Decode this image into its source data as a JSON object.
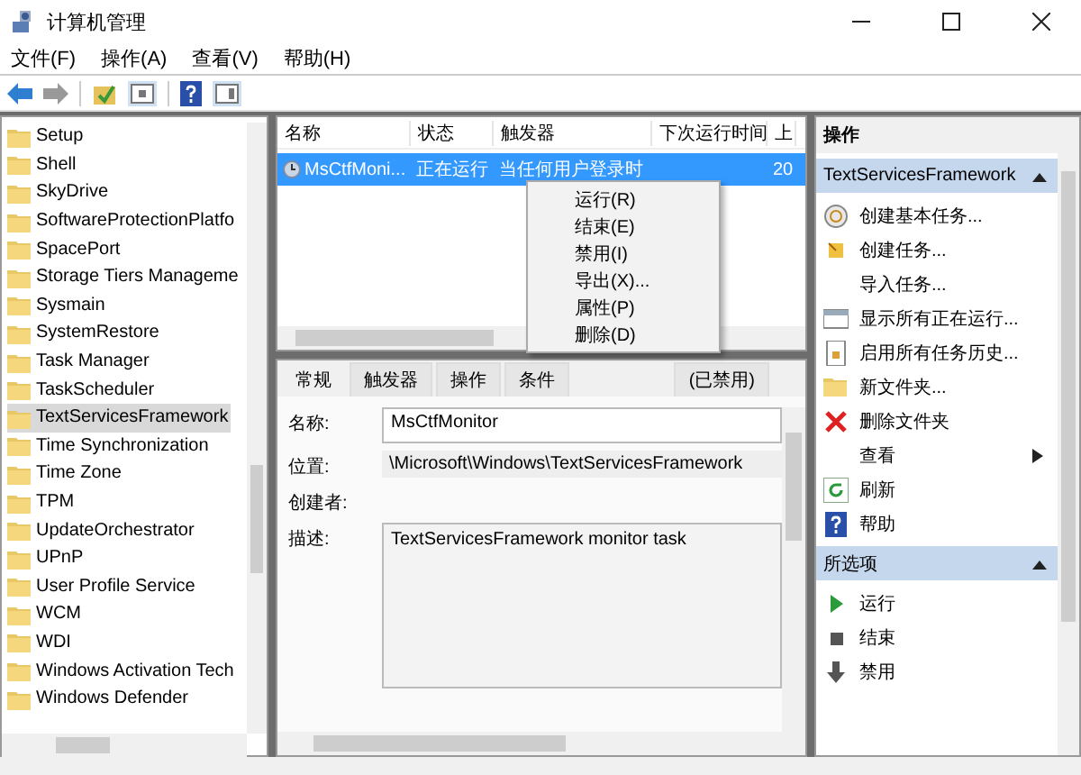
{
  "window": {
    "title": "计算机管理"
  },
  "menu": [
    "文件(F)",
    "操作(A)",
    "查看(V)",
    "帮助(H)"
  ],
  "tree": {
    "items": [
      {
        "label": "Setup",
        "selected": false
      },
      {
        "label": "Shell",
        "selected": false
      },
      {
        "label": "SkyDrive",
        "selected": false
      },
      {
        "label": "SoftwareProtectionPlatfo",
        "selected": false
      },
      {
        "label": "SpacePort",
        "selected": false
      },
      {
        "label": "Storage Tiers Manageme",
        "selected": false
      },
      {
        "label": "Sysmain",
        "selected": false
      },
      {
        "label": "SystemRestore",
        "selected": false
      },
      {
        "label": "Task Manager",
        "selected": false
      },
      {
        "label": "TaskScheduler",
        "selected": false
      },
      {
        "label": "TextServicesFramework",
        "selected": true
      },
      {
        "label": "Time Synchronization",
        "selected": false
      },
      {
        "label": "Time Zone",
        "selected": false
      },
      {
        "label": "TPM",
        "selected": false
      },
      {
        "label": "UpdateOrchestrator",
        "selected": false
      },
      {
        "label": "UPnP",
        "selected": false
      },
      {
        "label": "User Profile Service",
        "selected": false
      },
      {
        "label": "WCM",
        "selected": false
      },
      {
        "label": "WDI",
        "selected": false
      },
      {
        "label": "Windows Activation Tech",
        "selected": false
      },
      {
        "label": "Windows Defender",
        "selected": false
      }
    ]
  },
  "task_list": {
    "columns": [
      "名称",
      "状态",
      "触发器",
      "下次运行时间",
      "上"
    ],
    "rows": [
      {
        "cells": [
          "MsCtfMoni...",
          "正在运行",
          "当任何用户登录时",
          null,
          "20"
        ],
        "selected": true
      }
    ]
  },
  "context_menu": {
    "items": [
      "运行(R)",
      "结束(E)",
      "禁用(I)",
      "导出(X)...",
      "属性(P)",
      "删除(D)"
    ]
  },
  "detail": {
    "tabs": [
      {
        "label": "常规",
        "selected": true
      },
      {
        "label": "触发器",
        "selected": false
      },
      {
        "label": "操作",
        "selected": false
      },
      {
        "label": "条件",
        "selected": false
      },
      {
        "label": "(已禁用)",
        "selected": false
      }
    ],
    "fields": [
      {
        "kind": "field",
        "label": "名称:",
        "value": "MsCtfMonitor"
      },
      {
        "kind": "text",
        "label": "位置:",
        "value": "\\Microsoft\\Windows\\TextServicesFramework"
      },
      {
        "kind": "text",
        "label": "创建者:"
      },
      {
        "kind": "area",
        "label": "描述:",
        "value": "TextServicesFramework monitor task"
      }
    ]
  },
  "actions": {
    "title": "操作",
    "sections": [
      {
        "title": "TextServicesFramework",
        "expanded": true,
        "items": [
          {
            "label": "创建基本任务...",
            "submenu": false
          },
          {
            "label": "创建任务...",
            "submenu": false
          },
          {
            "label": "导入任务...",
            "submenu": false
          },
          {
            "label": "显示所有正在运行...",
            "submenu": false
          },
          {
            "label": "启用所有任务历史...",
            "submenu": false
          },
          {
            "label": "新文件夹...",
            "submenu": false
          },
          {
            "label": "删除文件夹",
            "submenu": false
          },
          {
            "label": "查看",
            "submenu": true
          },
          {
            "label": "刷新",
            "submenu": false
          },
          {
            "label": "帮助",
            "submenu": false
          }
        ]
      },
      {
        "title": "所选项",
        "expanded": true,
        "items": [
          {
            "label": "运行",
            "submenu": false
          },
          {
            "label": "结束",
            "submenu": false
          },
          {
            "label": "禁用",
            "submenu": false
          }
        ]
      }
    ]
  }
}
